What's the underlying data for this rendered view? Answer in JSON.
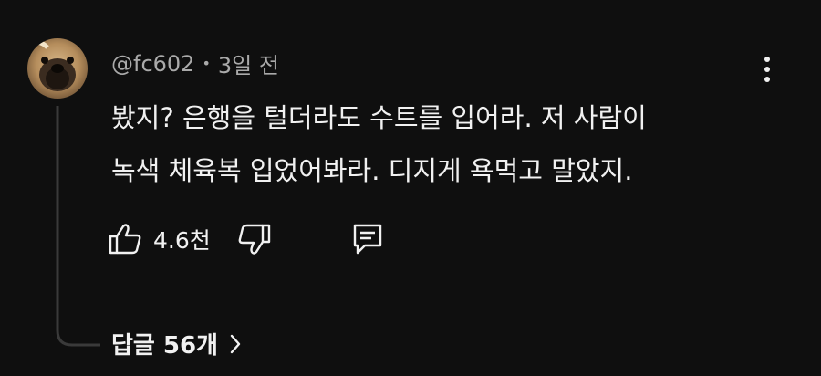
{
  "comment": {
    "handle": "@fc602",
    "separator": "•",
    "time_ago": "3일 전",
    "text_lines": [
      "봤지? 은행을 털더라도 수트를 입어라. 저 사람이",
      "녹색 체육복 입었어봐라. 디지게 욕먹고 말았지."
    ],
    "like_count": "4.6천",
    "replies_label": "답글 56개"
  },
  "icons": {
    "avatar": "dog-avatar",
    "more": "more-vert-icon",
    "like": "thumb-up-icon",
    "dislike": "thumb-down-icon",
    "reply": "reply-comment-icon",
    "chevron": "chevron-right-icon"
  },
  "colors": {
    "background": "#0f0f0f",
    "primary_text": "#f1f1f1",
    "secondary_text": "#aaaaaa",
    "thread_line": "#3a3a3a"
  }
}
